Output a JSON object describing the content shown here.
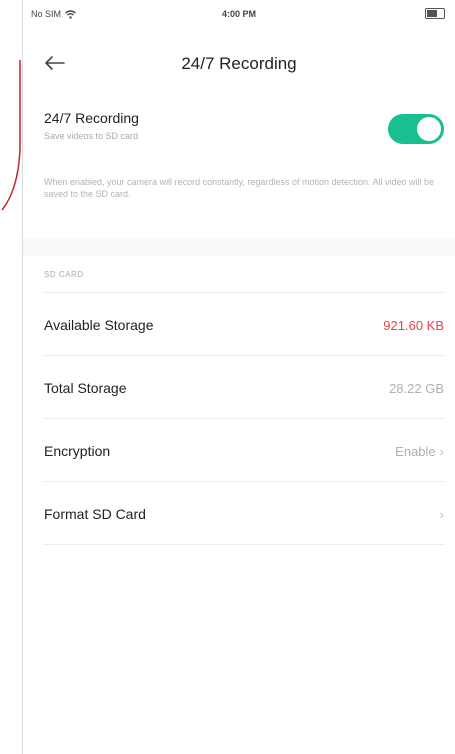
{
  "status_bar": {
    "carrier": "No SIM",
    "time": "4:00 PM"
  },
  "nav": {
    "title": "24/7 Recording"
  },
  "recording": {
    "title": "24/7 Recording",
    "subtitle": "Save videos to SD card",
    "toggle_on": true,
    "description": "When enabled, your camera will record constantly, regardless of motion detection. All video will be saved to the SD card."
  },
  "sd_card": {
    "section_label": "SD CARD",
    "rows": [
      {
        "label": "Available Storage",
        "value": "921.60 KB",
        "value_color": "#e8424f"
      },
      {
        "label": "Total Storage",
        "value": "28.22 GB"
      },
      {
        "label": "Encryption",
        "value": "Enable",
        "chevron": "›"
      },
      {
        "label": "Format SD Card",
        "value": "",
        "chevron": "›"
      }
    ]
  },
  "colors": {
    "accent": "#19bf8f",
    "warning": "#e8424f",
    "annotation": "#c0262d"
  },
  "icons": [
    "wifi-icon",
    "battery-icon",
    "back-arrow-icon",
    "chevron-right-icon"
  ]
}
